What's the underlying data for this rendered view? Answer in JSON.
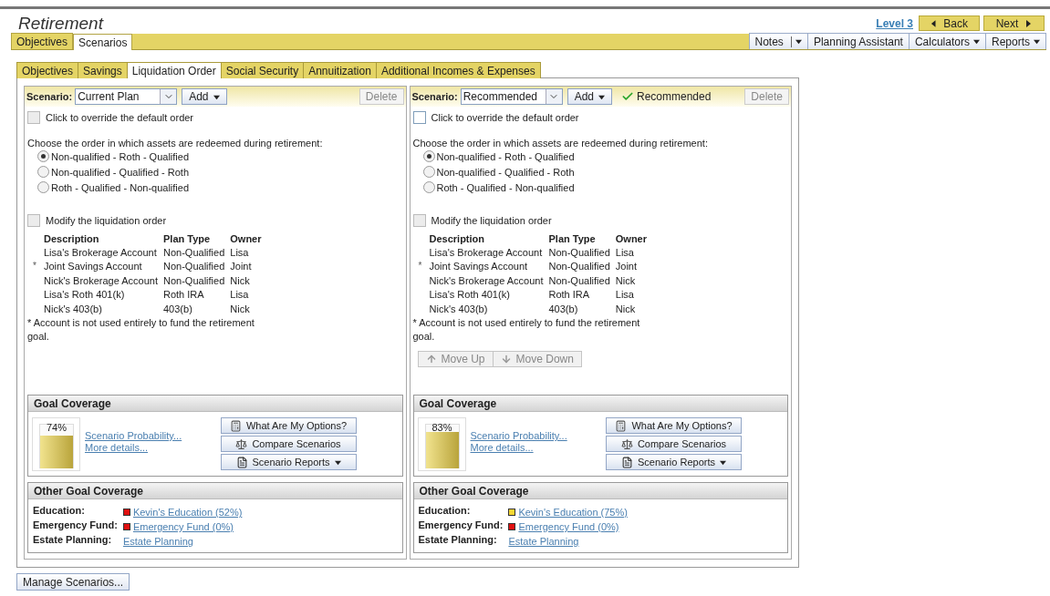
{
  "page_title": "Retirement",
  "level_link": "Level 3",
  "nav_buttons": [
    {
      "label": "Back",
      "kind": "back"
    },
    {
      "label": "Next",
      "kind": "next"
    }
  ],
  "main_tabs": [
    {
      "label": "Objectives",
      "selected": false
    },
    {
      "label": "Scenarios",
      "selected": true
    }
  ],
  "toolbar": [
    {
      "label": "Notes",
      "kind": "split"
    },
    {
      "label": "Planning Assistant",
      "kind": "plain"
    },
    {
      "label": "Calculators",
      "kind": "menu"
    },
    {
      "label": "Reports",
      "kind": "menu"
    }
  ],
  "sub_tabs": [
    {
      "label": "Objectives",
      "selected": false
    },
    {
      "label": "Savings",
      "selected": false
    },
    {
      "label": "Liquidation Order",
      "selected": true
    },
    {
      "label": "Social Security",
      "selected": false
    },
    {
      "label": "Annuitization",
      "selected": false
    },
    {
      "label": "Additional Incomes & Expenses",
      "selected": false
    }
  ],
  "scenarios": [
    {
      "scenario_label": "Scenario:",
      "scenario_value": "Current Plan",
      "add_button": "Add",
      "delete_button": "Delete",
      "override": {
        "label": "Click to override the default order",
        "checked": false,
        "disabled": true
      },
      "order_prompt": "Choose the order in which assets are redeemed during retirement:",
      "order_options": [
        {
          "label": "Non-qualified - Roth - Qualified",
          "selected": true
        },
        {
          "label": "Non-qualified - Qualified - Roth",
          "selected": false
        },
        {
          "label": "Roth - Qualified - Non-qualified",
          "selected": false
        }
      ],
      "modify": {
        "label": "Modify the liquidation order",
        "checked": false,
        "disabled": true
      },
      "table": {
        "columns": [
          "Description",
          "Plan Type",
          "Owner"
        ],
        "rows": [
          {
            "description": "Lisa's Brokerage Account",
            "plan_type": "Non-Qualified",
            "owner": "Lisa"
          },
          {
            "marker": "*",
            "description": "Joint Savings Account",
            "plan_type": "Non-Qualified",
            "owner": "Joint"
          },
          {
            "description": "Nick's Brokerage Account",
            "plan_type": "Non-Qualified",
            "owner": "Nick"
          },
          {
            "description": "Lisa's Roth 401(k)",
            "plan_type": "Roth IRA",
            "owner": "Lisa"
          },
          {
            "description": "Nick's 403(b)",
            "plan_type": "403(b)",
            "owner": "Nick"
          }
        ]
      },
      "footnote": "* Account is not used entirely to fund the retirement goal.",
      "goal_coverage": {
        "title": "Goal Coverage",
        "percent": "74%",
        "level": 0.74,
        "links": [
          "Scenario Probability...",
          "More details..."
        ],
        "buttons": [
          {
            "label": "What Are My Options?",
            "kind": "calculator"
          },
          {
            "label": "Compare Scenarios",
            "kind": "scales"
          },
          {
            "label": "Scenario Reports",
            "kind": "report"
          }
        ]
      },
      "other_goal_coverage": {
        "title": "Other Goal Coverage",
        "rows": [
          {
            "label": "Education:",
            "link": "Kevin's Education (52%)",
            "color": "#e01010"
          },
          {
            "label": "Emergency Fund:",
            "link": "Emergency Fund (0%)",
            "color": "#e01010"
          },
          {
            "label": "Estate Planning:",
            "link": "Estate Planning"
          }
        ]
      }
    },
    {
      "scenario_label": "Scenario:",
      "scenario_value": "Recommended",
      "add_button": "Add",
      "recommended_badge": "Recommended",
      "delete_button": "Delete",
      "override": {
        "label": "Click to override the default order",
        "checked": false,
        "disabled": false
      },
      "order_prompt": "Choose the order in which assets are redeemed during retirement:",
      "order_options": [
        {
          "label": "Non-qualified - Roth - Qualified",
          "selected": true
        },
        {
          "label": "Non-qualified - Qualified - Roth",
          "selected": false
        },
        {
          "label": "Roth - Qualified - Non-qualified",
          "selected": false
        }
      ],
      "modify": {
        "label": "Modify the liquidation order",
        "checked": false,
        "disabled": true
      },
      "table": {
        "columns": [
          "Description",
          "Plan Type",
          "Owner"
        ],
        "rows": [
          {
            "description": "Lisa's Brokerage Account",
            "plan_type": "Non-Qualified",
            "owner": "Lisa"
          },
          {
            "marker": "*",
            "description": "Joint Savings Account",
            "plan_type": "Non-Qualified",
            "owner": "Joint"
          },
          {
            "description": "Nick's Brokerage Account",
            "plan_type": "Non-Qualified",
            "owner": "Nick"
          },
          {
            "description": "Lisa's Roth 401(k)",
            "plan_type": "Roth IRA",
            "owner": "Lisa"
          },
          {
            "description": "Nick's 403(b)",
            "plan_type": "403(b)",
            "owner": "Nick"
          }
        ]
      },
      "footnote": "* Account is not used entirely to fund the retirement goal.",
      "move_buttons": [
        {
          "label": "Move Up",
          "kind": "up",
          "disabled": true
        },
        {
          "label": "Move Down",
          "kind": "down",
          "disabled": true
        }
      ],
      "goal_coverage": {
        "title": "Goal Coverage",
        "percent": "83%",
        "level": 0.83,
        "links": [
          "Scenario Probability...",
          "More details..."
        ],
        "buttons": [
          {
            "label": "What Are My Options?",
            "kind": "calculator"
          },
          {
            "label": "Compare Scenarios",
            "kind": "scales"
          },
          {
            "label": "Scenario Reports",
            "kind": "report"
          }
        ]
      },
      "other_goal_coverage": {
        "title": "Other Goal Coverage",
        "rows": [
          {
            "label": "Education:",
            "link": "Kevin's Education (75%)",
            "color": "#f5d633"
          },
          {
            "label": "Emergency Fund:",
            "link": "Emergency Fund (0%)",
            "color": "#e01010"
          },
          {
            "label": "Estate Planning:",
            "link": "Estate Planning"
          }
        ]
      }
    }
  ],
  "manage_button": "Manage Scenarios..."
}
